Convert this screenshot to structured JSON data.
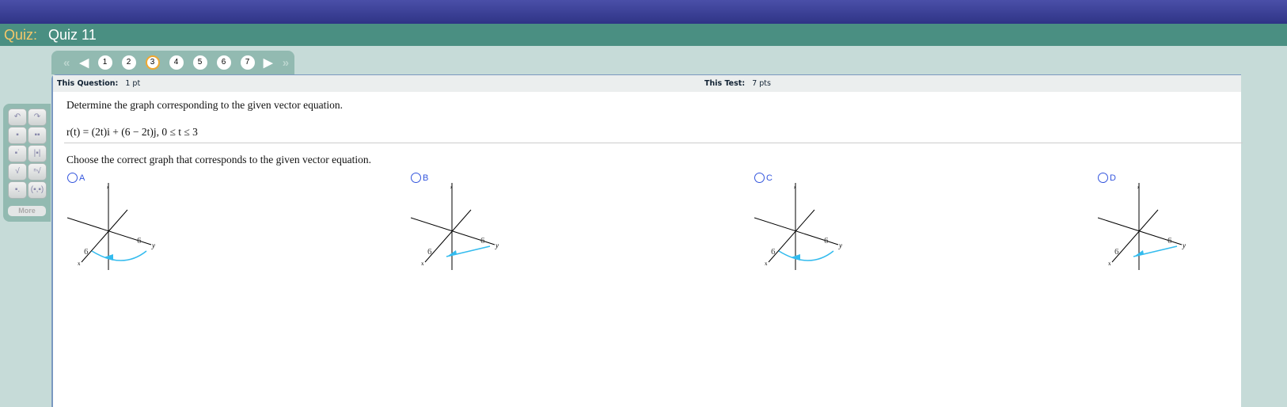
{
  "header": {
    "label": "Quiz:",
    "title": "Quiz 11"
  },
  "nav": {
    "questions": [
      "1",
      "2",
      "3",
      "4",
      "5",
      "6",
      "7"
    ],
    "current": "3"
  },
  "question_header": {
    "question_label": "This Question:",
    "question_value": "1 pt",
    "test_label": "This Test:",
    "test_value": "7 pts"
  },
  "question": {
    "prompt": "Determine the graph corresponding to the given vector equation.",
    "equation": "r(t) = (2t)i + (6 − 2t)j, 0 ≤ t ≤ 3",
    "instruction": "Choose the correct graph that corresponds to the given vector equation."
  },
  "options": [
    {
      "label": "A",
      "curve": "curved",
      "arrow": "toward-x"
    },
    {
      "label": "B",
      "curve": "straight",
      "arrow": "toward-x"
    },
    {
      "label": "C",
      "curve": "curved",
      "arrow": "toward-x"
    },
    {
      "label": "D",
      "curve": "straight",
      "arrow": "toward-x"
    }
  ],
  "axes": {
    "z": "z",
    "y": "y",
    "x": "x",
    "tick": "6"
  },
  "tools": {
    "more": "More"
  },
  "colors": {
    "curve": "#33bbee",
    "accent": "#f5c86a",
    "teal": "#4a8f82"
  }
}
